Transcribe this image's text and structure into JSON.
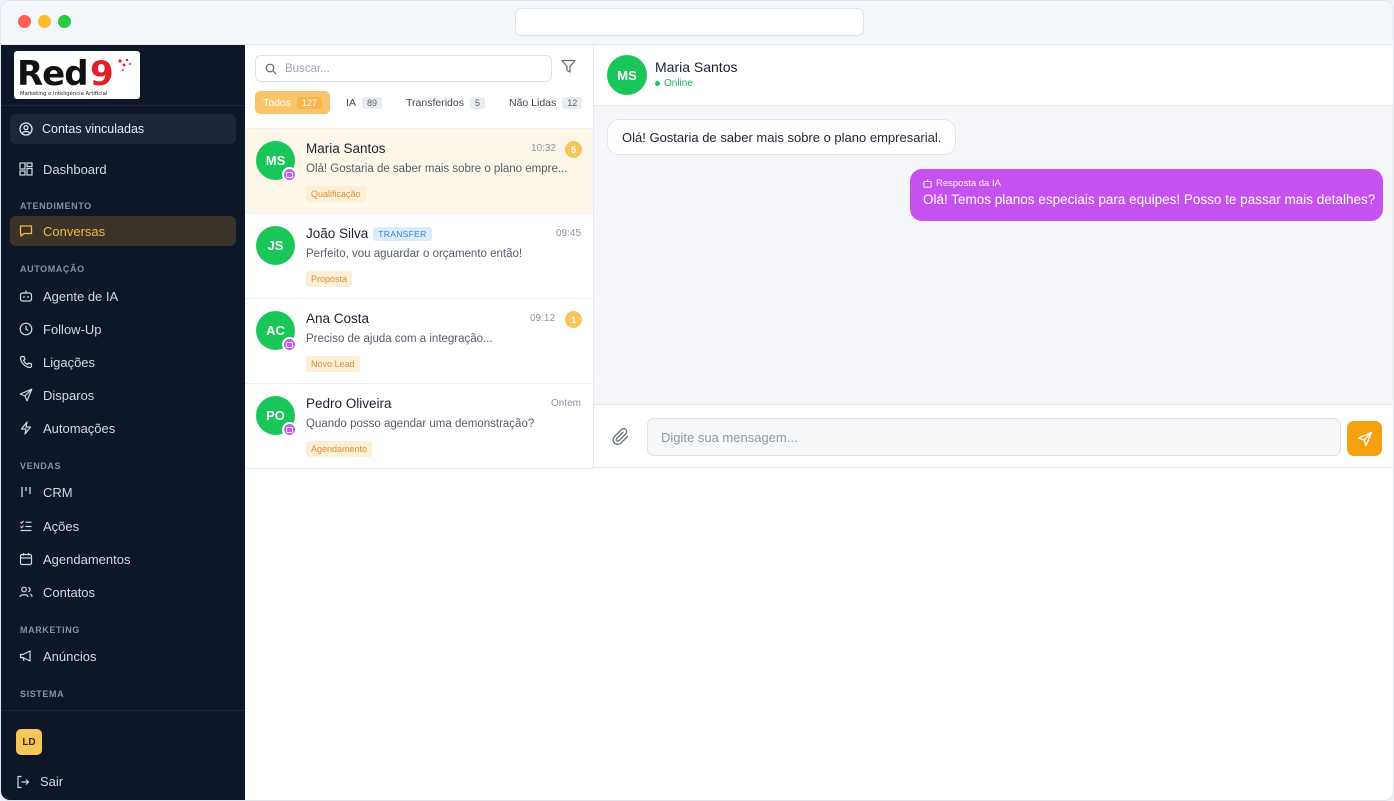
{
  "brand": {
    "logo_text": "Red9",
    "logo_tagline": "Marketing e Inteligência Artificial"
  },
  "sidebar": {
    "linked_accounts": "Contas vinculadas",
    "dashboard": "Dashboard",
    "sections": {
      "atendimento": "ATENDIMENTO",
      "automacao": "AUTOMAÇÃO",
      "vendas": "VENDAS",
      "marketing": "MARKETING",
      "sistema": "SISTEMA"
    },
    "items": {
      "conversas": "Conversas",
      "agente": "Agente de IA",
      "followup": "Follow-Up",
      "ligacoes": "Ligações",
      "disparos": "Disparos",
      "automacoes": "Automações",
      "crm": "CRM",
      "acoes": "Ações",
      "agendamentos": "Agendamentos",
      "contatos": "Contatos",
      "anuncios": "Anúncios"
    },
    "user_initials": "LD",
    "logout": "Sair",
    "accent_color": "#f4b740"
  },
  "list": {
    "search_placeholder": "Buscar...",
    "tabs": [
      {
        "label": "Todos",
        "count": "127"
      },
      {
        "label": "IA",
        "count": "89"
      },
      {
        "label": "Transferidos",
        "count": "5"
      },
      {
        "label": "Não Lidas",
        "count": "12"
      }
    ],
    "conversations": [
      {
        "initials": "MS",
        "name": "Maria Santos",
        "time": "10:32",
        "unread": "5",
        "preview": "Olá! Gostaria de saber mais sobre o plano empre...",
        "tag": "Qualificação"
      },
      {
        "initials": "JS",
        "name": "João Silva",
        "badge": "TRANSFER",
        "time": "09:45",
        "preview": "Perfeito, vou aguardar o orçamento então!",
        "tag": "Proposta"
      },
      {
        "initials": "AC",
        "name": "Ana Costa",
        "time": "09:12",
        "unread": "1",
        "preview": "Preciso de ajuda com a integração...",
        "tag": "Novo Lead"
      },
      {
        "initials": "PO",
        "name": "Pedro Oliveira",
        "time": "Ontem",
        "preview": "Quando posso agendar uma demonstração?",
        "tag": "Agendamento"
      }
    ]
  },
  "chat": {
    "contact_initials": "MS",
    "contact_name": "Maria Santos",
    "status": "Online",
    "incoming_message": "Olá! Gostaria de saber mais sobre o plano empresarial.",
    "ai_label": "Resposta da IA",
    "outgoing_message": "Olá! Temos planos especiais para equipes! Posso te passar mais detalhes?",
    "input_placeholder": "Digite sua mensagem...",
    "ai_bubble_color": "#c552ee",
    "send_color": "#f5a00f"
  }
}
